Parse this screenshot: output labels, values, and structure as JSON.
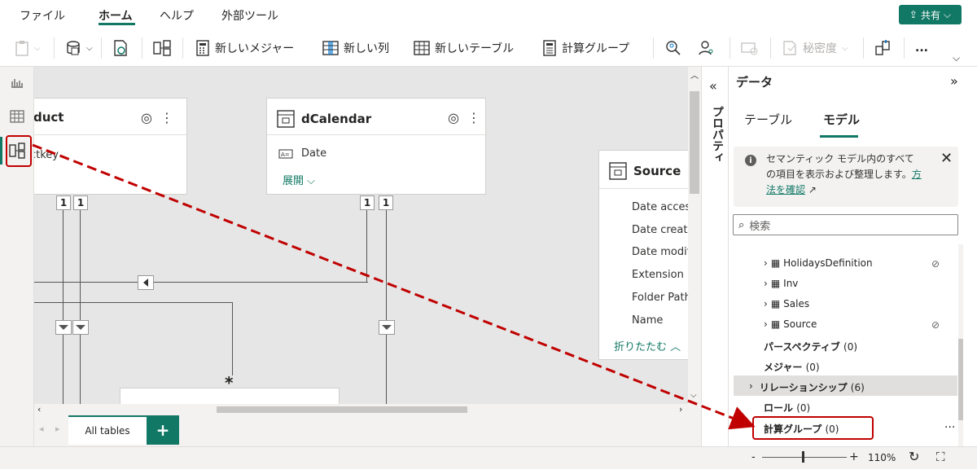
{
  "menu": {
    "items": [
      "ファイル",
      "ホーム",
      "ヘルプ",
      "外部ツール"
    ],
    "share_label": "共有"
  },
  "ribbon": {
    "new_measure": "新しいメジャー",
    "new_column": "新しい列",
    "new_table": "新しいテーブル",
    "calc_group": "計算グループ",
    "sensitivity": "秘密度",
    "more": "..."
  },
  "canvas": {
    "product_card": {
      "title": "duct",
      "field": "ctkey"
    },
    "dcalendar_card": {
      "title": "dCalendar",
      "field": "Date",
      "expand": "展開"
    },
    "source_card": {
      "title": "Source",
      "fields": [
        "Date access",
        "Date create",
        "Date modif",
        "Extension",
        "Folder Path",
        "Name"
      ],
      "collapse": "折りたたむ"
    },
    "badges": [
      "1",
      "1",
      "1",
      "1"
    ],
    "star": "*",
    "tabs": {
      "all_tables": "All tables",
      "add": "+"
    }
  },
  "properties_pane": {
    "label": "プロパティ"
  },
  "data_pane": {
    "title": "データ",
    "tabs": [
      "テーブル",
      "モデル"
    ],
    "active_tab": "モデル",
    "info_text_1": "セマンティック モデル内のすべて",
    "info_text_2": "の項目を表示および整理します。",
    "info_link_1": "方",
    "info_link_2": "法を確認",
    "search_placeholder": "検索",
    "tables": [
      {
        "name": "HolidaysDefinition",
        "hidden": true
      },
      {
        "name": "Inv",
        "hidden": false
      },
      {
        "name": "Sales",
        "hidden": false
      },
      {
        "name": "Source",
        "hidden": true
      }
    ],
    "categories": [
      {
        "label": "パースペクティブ",
        "count": "(0)"
      },
      {
        "label": "メジャー",
        "count": "(0)"
      },
      {
        "label": "リレーションシップ",
        "count": "(6)"
      },
      {
        "label": "ロール",
        "count": "(0)"
      },
      {
        "label": "計算グループ",
        "count": "(0)"
      }
    ],
    "more": "..."
  },
  "status": {
    "zoom": "110%",
    "minus": "-",
    "plus": "+"
  },
  "colors": {
    "accent": "#117865",
    "highlight": "#c00000"
  }
}
